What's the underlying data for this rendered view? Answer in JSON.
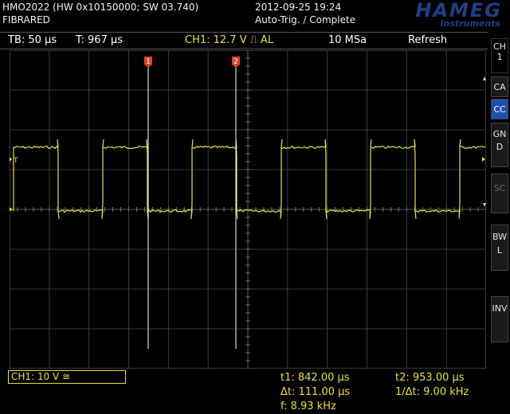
{
  "header": {
    "model_line": "HMO2022 (HW 0x10150000; SW 03.740)",
    "device_name": "FIBRARED",
    "datetime": "2012-09-25 19:24",
    "trigger_status": "Auto-Trig. / Complete",
    "logo_main": "HAMEG",
    "logo_sub": "Instruments"
  },
  "status": {
    "timebase": "TB: 50 µs",
    "trigger_time": "T: 967 µs",
    "channel_trigger": "CH1: 12.7 V ⎍ AL",
    "sample_rate": "10 MSa",
    "mode": "Refresh"
  },
  "softkeys": {
    "channel": "CH1",
    "ca": "CA",
    "cc": "CC",
    "gnd": "GND",
    "sc": "SC",
    "bwl": "BWL",
    "inv": "INV"
  },
  "markers": {
    "cursor1": "1",
    "cursor2": "2",
    "ch1_ground": "1",
    "trigger": "T"
  },
  "bottom": {
    "channel_setting": "CH1: 10 V ≅",
    "t1": "t1: 842.00 µs",
    "t2": "t2: 953.00 µs",
    "dt": "Δt: 111.00 µs",
    "inv_dt": "1/Δt: 9.00 kHz",
    "freq": "f: 8.93 kHz"
  },
  "colors": {
    "trace": "#e8e230",
    "cursor": "#ffffff",
    "cursor_marker": "#e0402a",
    "accent": "#1d4fb0",
    "grid": "#4a4a4a"
  }
}
